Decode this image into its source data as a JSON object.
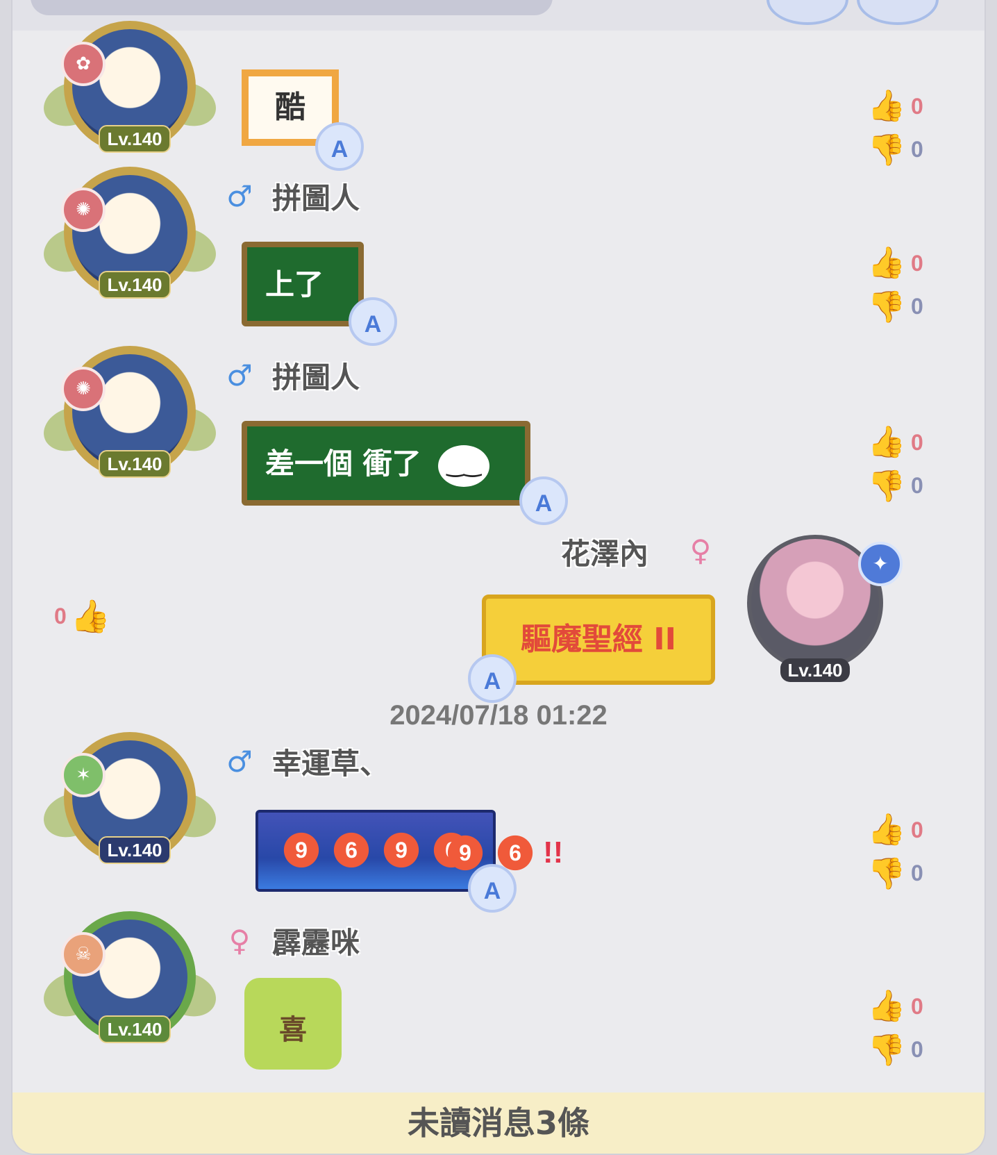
{
  "messages": [
    {
      "name": "",
      "gender": "male",
      "level": "Lv.140",
      "text": "酷",
      "likes": "0",
      "dislikes": "0"
    },
    {
      "name": "拼圖人",
      "gender": "male",
      "level": "Lv.140",
      "text": "上了",
      "likes": "0",
      "dislikes": "0"
    },
    {
      "name": "拼圖人",
      "gender": "male",
      "level": "Lv.140",
      "text": "差一個 衝了",
      "likes": "0",
      "dislikes": "0"
    },
    {
      "name": "花澤內",
      "gender": "female",
      "level": "Lv.140",
      "text": "驅魔聖經 II",
      "likes": "0"
    },
    {
      "name": "幸運草、",
      "gender": "male",
      "level": "Lv.140",
      "text": "969696!!",
      "digits": [
        "9",
        "6",
        "9",
        "6",
        "9",
        "6"
      ],
      "exclaim": "!!",
      "likes": "0",
      "dislikes": "0"
    },
    {
      "name": "霹靂咪",
      "gender": "female",
      "level": "Lv.140",
      "text": "喜",
      "likes": "0",
      "dislikes": "0"
    }
  ],
  "timestamp": "2024/07/18 01:22",
  "unread_banner": "未讀消息3條",
  "icons": {
    "male": "♂",
    "female": "♀",
    "auto": "A",
    "like": "👍",
    "dislike": "👎"
  },
  "colors": {
    "like": "#e07a86",
    "dislike": "#8990b4",
    "bubble_green": "#1f6b2e",
    "bubble_gold": "#f5cf3a"
  }
}
